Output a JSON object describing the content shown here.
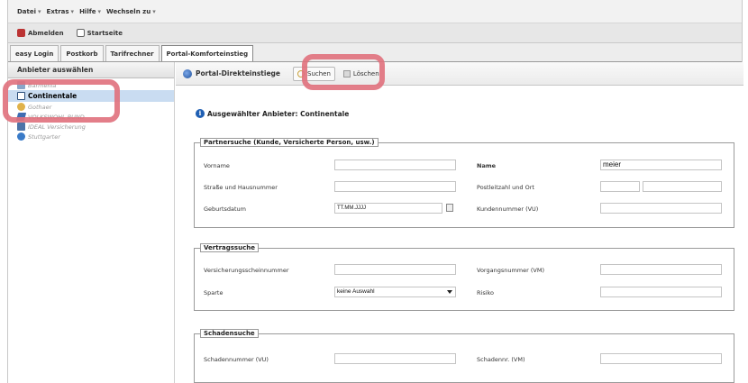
{
  "menu": {
    "items": [
      "Datei",
      "Extras",
      "Hilfe",
      "Wechseln zu"
    ]
  },
  "toolbar": {
    "logout_label": "Abmelden",
    "home_label": "Startseite"
  },
  "tabs": [
    {
      "label": "easy Login"
    },
    {
      "label": "Postkorb"
    },
    {
      "label": "Tarifrechner"
    },
    {
      "label": "Portal-Komforteinstieg",
      "active": true
    }
  ],
  "sidebar": {
    "header": "Anbieter auswählen",
    "items": [
      {
        "label": "Barmenia",
        "icon": "barmenia-icon"
      },
      {
        "label": "Continentale",
        "icon": "continentale-icon",
        "selected": true
      },
      {
        "label": "Gothaer",
        "icon": "gothaer-icon"
      },
      {
        "label": "VOLKSWOHL BUND",
        "icon": "volkswohl-icon"
      },
      {
        "label": "IDEAL Versicherung",
        "icon": "ideal-icon"
      },
      {
        "label": "Stuttgarter",
        "icon": "stuttgarter-icon"
      }
    ]
  },
  "main": {
    "title": "Portal-Direkteinstiege",
    "search_label": "Suchen",
    "clear_label": "Löschen",
    "provider_text": "Ausgewählter Anbieter: Continentale"
  },
  "partner": {
    "legend": "Partnersuche (Kunde, Versicherte Person, usw.)",
    "vorname_label": "Vorname",
    "vorname_value": "",
    "name_label": "Name",
    "name_value": "meier",
    "strasse_label": "Straße und Hausnummer",
    "strasse_value": "",
    "plz_label": "Postleitzahl und Ort",
    "plz_value": "",
    "ort_value": "",
    "geburtsdatum_label": "Geburtsdatum",
    "geburtsdatum_value": "TT.MM.JJJJ",
    "kundennummer_label": "Kundennummer (VU)",
    "kundennummer_value": ""
  },
  "vertrag": {
    "legend": "Vertragssuche",
    "vsnr_label": "Versicherungsscheinnummer",
    "vsnr_value": "",
    "vorgang_label": "Vorgangsnummer (VM)",
    "vorgang_value": "",
    "sparte_label": "Sparte",
    "sparte_value": "keine Auswahl",
    "risiko_label": "Risiko",
    "risiko_value": ""
  },
  "schaden": {
    "legend": "Schadensuche",
    "snr_vu_label": "Schadennummer (VU)",
    "snr_vu_value": "",
    "snr_vm_label": "Schadennr. (VM)",
    "snr_vm_value": ""
  },
  "colors": {
    "highlight": "#e0707c",
    "selection": "#c9dcf1"
  }
}
